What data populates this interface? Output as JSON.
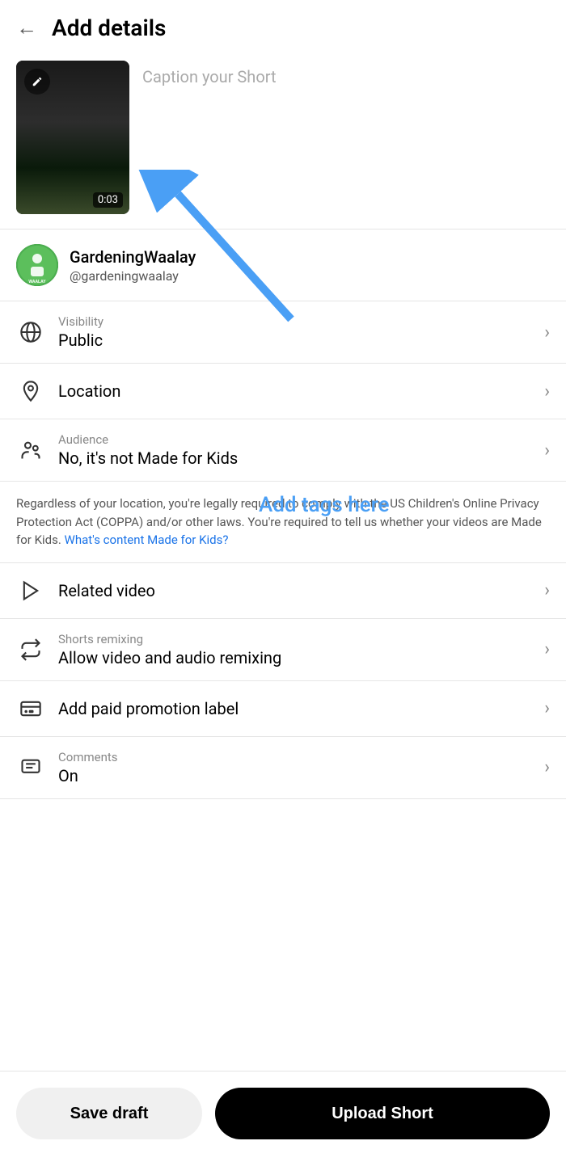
{
  "header": {
    "title": "Add details",
    "back_label": "back"
  },
  "caption": {
    "placeholder": "Caption your Short",
    "duration": "0:03"
  },
  "account": {
    "name": "GardeningWaalay",
    "handle": "@gardeningwaalay",
    "avatar_text": "Gardening\nWAALAY"
  },
  "menu_items": [
    {
      "id": "visibility",
      "sublabel": "Visibility",
      "label": "Public",
      "has_sublabel": true
    },
    {
      "id": "location",
      "sublabel": "",
      "label": "Location",
      "has_sublabel": false
    },
    {
      "id": "audience",
      "sublabel": "Audience",
      "label": "No, it's not Made for Kids",
      "has_sublabel": true
    }
  ],
  "coppa": {
    "text": "Regardless of your location, you're legally required to comply with the US Children's Online Privacy Protection Act (COPPA) and/or other laws. You're required to tell us whether your videos are Made for Kids.",
    "link_text": "What's content Made for Kids?",
    "link_url": "#"
  },
  "menu_items2": [
    {
      "id": "related_video",
      "sublabel": "",
      "label": "Related video",
      "has_sublabel": false
    },
    {
      "id": "shorts_remixing",
      "sublabel": "Shorts remixing",
      "label": "Allow video and audio remixing",
      "has_sublabel": true
    },
    {
      "id": "paid_promotion",
      "sublabel": "",
      "label": "Add paid promotion label",
      "has_sublabel": false
    },
    {
      "id": "comments",
      "sublabel": "Comments",
      "label": "On",
      "has_sublabel": true
    }
  ],
  "annotation": {
    "text": "Add tags here"
  },
  "buttons": {
    "save_draft": "Save draft",
    "upload": "Upload Short"
  }
}
